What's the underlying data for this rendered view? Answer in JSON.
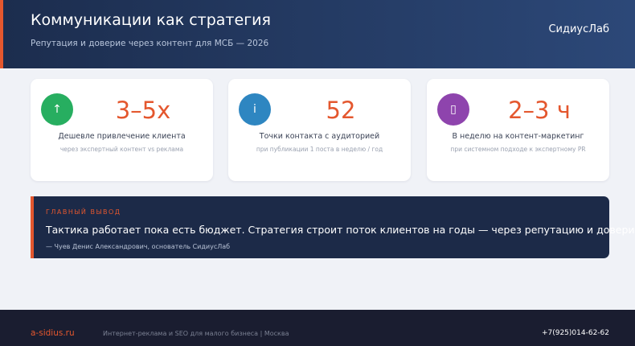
{
  "header": {
    "title": "Коммуникации как стратегия",
    "subtitle": "Репутация и доверие через контент для МСБ — 2026",
    "brand": "СидиусЛаб"
  },
  "cards": [
    {
      "icon": "arrow-up-icon",
      "glyph": "↑",
      "color": "#27ae60",
      "value": "3–5x",
      "label": "Дешевле привлечение клиента",
      "note": "через экспертный контент vs реклама"
    },
    {
      "icon": "info-icon",
      "glyph": "i",
      "color": "#2e86c1",
      "value": "52",
      "label": "Точки контакта с аудиторией",
      "note": "при публикации 1 поста в неделю / год"
    },
    {
      "icon": "placeholder-glyph-icon",
      "glyph": "▯",
      "color": "#8e44ad",
      "value": "2–3 ч",
      "label": "В неделю на контент-маркетинг",
      "note": "при системном подходе к экспертному PR"
    }
  ],
  "quote": {
    "kicker": "ГЛАВНЫЙ ВЫВОД",
    "text": "Тактика работает пока есть бюджет. Стратегия строит поток клиентов на годы — через репутацию и доверие.",
    "author": "— Чуев Денис Александрович, основатель СидиусЛаб"
  },
  "footer": {
    "site": "a-sidius.ru",
    "description": "Интернет-реклама и SEO для малого бизнеса | Москва",
    "phone": "+7(925)014-62-62"
  },
  "colors": {
    "accent": "#e4572e",
    "header_start": "#1c2d4e",
    "header_end": "#2c4878",
    "quote_bg": "#1c2a48",
    "footer_bg": "#1a1d30"
  }
}
